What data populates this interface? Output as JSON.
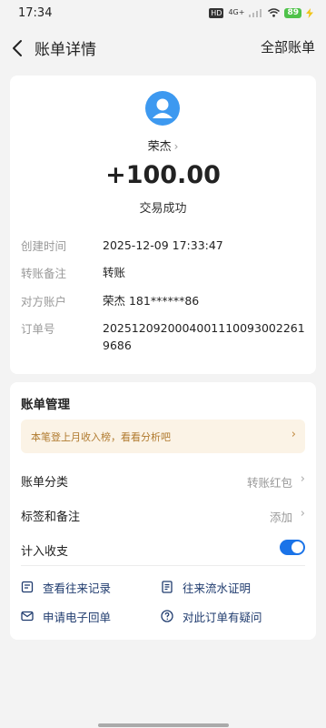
{
  "status_bar": {
    "time": "17:34",
    "hd": "HD",
    "network": "4G+",
    "battery": "89"
  },
  "header": {
    "title": "账单详情",
    "all_bills": "全部账单"
  },
  "transaction": {
    "payer": "荣杰",
    "amount": "+100.00",
    "status": "交易成功",
    "details": [
      {
        "label": "创建时间",
        "value": "2025-12-09 17:33:47"
      },
      {
        "label": "转账备注",
        "value": "转账"
      },
      {
        "label": "对方账户",
        "value": "荣杰 181******86"
      },
      {
        "label": "订单号",
        "value": "20251209200040011100930022619686"
      }
    ]
  },
  "management": {
    "title": "账单管理",
    "tip": "本笔登上月收入榜，看看分析吧",
    "options": [
      {
        "label": "账单分类",
        "value": "转账红包"
      },
      {
        "label": "标签和备注",
        "value": "添加"
      },
      {
        "label": "计入收支",
        "toggle_on": true
      }
    ],
    "actions": [
      {
        "label": "查看往来记录",
        "icon": "records-icon"
      },
      {
        "label": "往来流水证明",
        "icon": "statement-icon"
      },
      {
        "label": "申请电子回单",
        "icon": "mail-icon"
      },
      {
        "label": "对此订单有疑问",
        "icon": "question-icon"
      }
    ]
  },
  "colors": {
    "accent": "#1a73e8",
    "avatar": "#3d99f0",
    "tip_bg": "#fbf3e6",
    "tip_text": "#b07a2e",
    "link": "#1f3b6e"
  }
}
